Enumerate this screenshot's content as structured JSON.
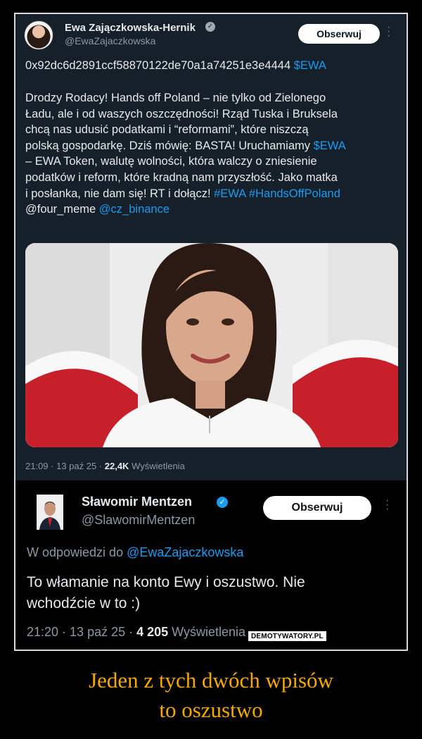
{
  "tweet1": {
    "author_name": "Ewa Zajączkowska-Hernik",
    "handle": "@EwaZajaczkowska",
    "follow_label": "Obserwuj",
    "more_icon": "more-options-icon",
    "address": "0x92dc6d2891ccf58870122de70a1a74251e3e4444",
    "address_ticker": "$EWA",
    "body_lines": [
      {
        "text": "Drodzy Rodacy! Hands off Poland – nie tylko od Zielonego",
        "link": ""
      },
      {
        "text": "Ładu, ale i od waszych oszczędności! Rząd Tuska i Bruksela",
        "link": ""
      },
      {
        "text": "chcą nas udusić podatkami i “reformami”, które niszczą",
        "link": ""
      },
      {
        "text": "polską gospodarkę. Dziś mówię: BASTA! Uruchamiamy ",
        "link": "$EWA"
      },
      {
        "text": "– EWA Token, walutę wolności, która walczy o zniesienie",
        "link": ""
      },
      {
        "text": "podatków i reform, które kradną nam przyszłość. Jako matka",
        "link": ""
      },
      {
        "text": "i posłanka, nie dam się! RT i dołącz! ",
        "link": "#EWA #HandsOffPoland"
      },
      {
        "text": "@four_meme ",
        "link": "@cz_binance"
      }
    ],
    "time": "21:09 · 13 paź 25 · ",
    "views_count": "22,4K",
    "views_label": " Wyświetlenia"
  },
  "tweet2": {
    "author_name": "Sławomir Mentzen",
    "handle": "@SlawomirMentzen",
    "follow_label": "Obserwuj",
    "reply_prefix": "W odpowiedzi do ",
    "reply_to": "@EwaZajaczkowska",
    "body_lines": [
      "To włamanie na konto Ewy i oszustwo. Nie",
      "wchodźcie w to :)"
    ],
    "time": "21:20 · 13 paź 25 · ",
    "views_count": "4 205",
    "views_label": " Wyświetlenia"
  },
  "watermark": "DEMOTYWATORY.PL",
  "caption": {
    "line1": "Jeden z tych dwóch wpisów",
    "line2": "to oszustwo"
  },
  "colors": {
    "accent": "#1d9bf0",
    "caption": "#f5a800"
  }
}
